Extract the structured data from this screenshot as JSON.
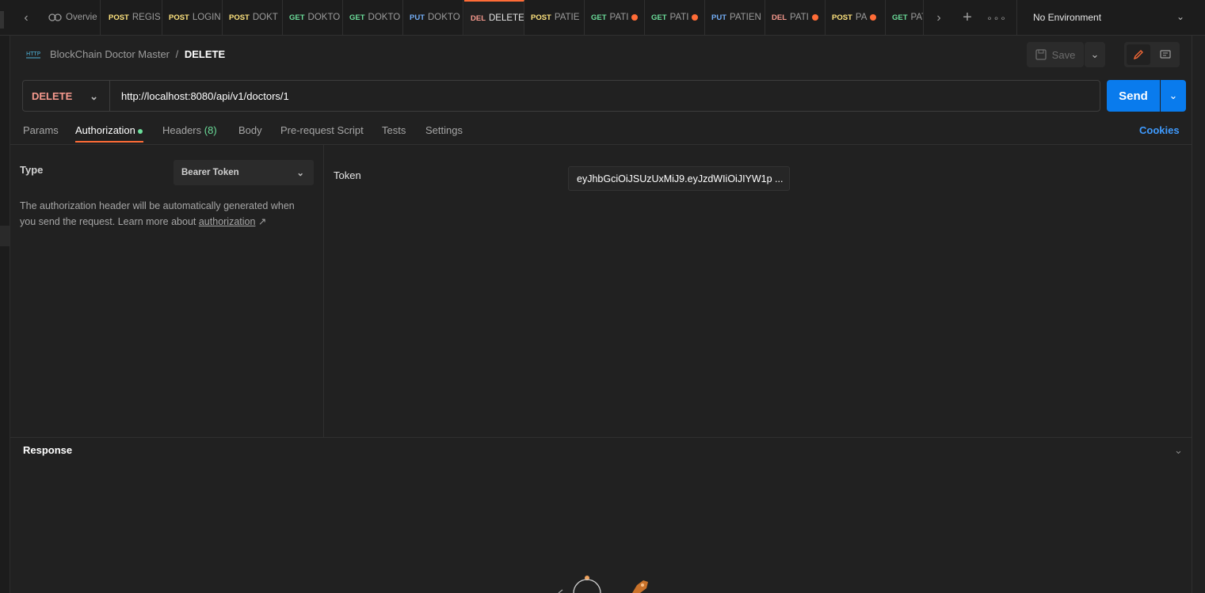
{
  "tabs": [
    {
      "method": "",
      "name": "Overvie",
      "dot": false
    },
    {
      "method": "POST",
      "name": "REGIS",
      "dot": false
    },
    {
      "method": "POST",
      "name": "LOGIN",
      "dot": false
    },
    {
      "method": "POST",
      "name": "DOKT",
      "dot": false
    },
    {
      "method": "GET",
      "name": "DOKTO",
      "dot": false
    },
    {
      "method": "GET",
      "name": "DOKTO",
      "dot": false
    },
    {
      "method": "PUT",
      "name": "DOKTO",
      "dot": false
    },
    {
      "method": "DEL",
      "name": "DELETE",
      "dot": false,
      "active": true
    },
    {
      "method": "POST",
      "name": "PATIE",
      "dot": false
    },
    {
      "method": "GET",
      "name": "PATI",
      "dot": true
    },
    {
      "method": "GET",
      "name": "PATI",
      "dot": true
    },
    {
      "method": "PUT",
      "name": "PATIEN",
      "dot": false
    },
    {
      "method": "DEL",
      "name": "PATI",
      "dot": true
    },
    {
      "method": "POST",
      "name": "PA",
      "dot": true
    },
    {
      "method": "GET",
      "name": "PAT",
      "dot": false
    }
  ],
  "environment": "No Environment",
  "breadcrumb": {
    "collection": "BlockChain Doctor Master",
    "separator": "/",
    "current": "DELETE"
  },
  "toolbar": {
    "save_label": "Save"
  },
  "request": {
    "method": "DELETE",
    "url": "http://localhost:8080/api/v1/doctors/1",
    "send_label": "Send"
  },
  "request_tabs": {
    "params": "Params",
    "authorization": "Authorization",
    "headers": "Headers",
    "headers_count": "(8)",
    "body": "Body",
    "prerequest": "Pre-request Script",
    "tests": "Tests",
    "settings": "Settings",
    "cookies": "Cookies"
  },
  "auth": {
    "type_label": "Type",
    "type_value": "Bearer Token",
    "description": "The authorization header will be automatically generated when you send the request. Learn more about",
    "link_text": "authorization",
    "link_arrow": "↗",
    "token_label": "Token",
    "token_value": "eyJhbGciOiJSUzUxMiJ9.eyJzdWIiOiJIYW1p ..."
  },
  "response": {
    "title": "Response"
  },
  "colors": {
    "accent": "#ff6c37",
    "send": "#097bed",
    "delete": "#f79a8e",
    "get": "#6bdd9a",
    "post": "#ffe47e",
    "put": "#74aef6"
  }
}
